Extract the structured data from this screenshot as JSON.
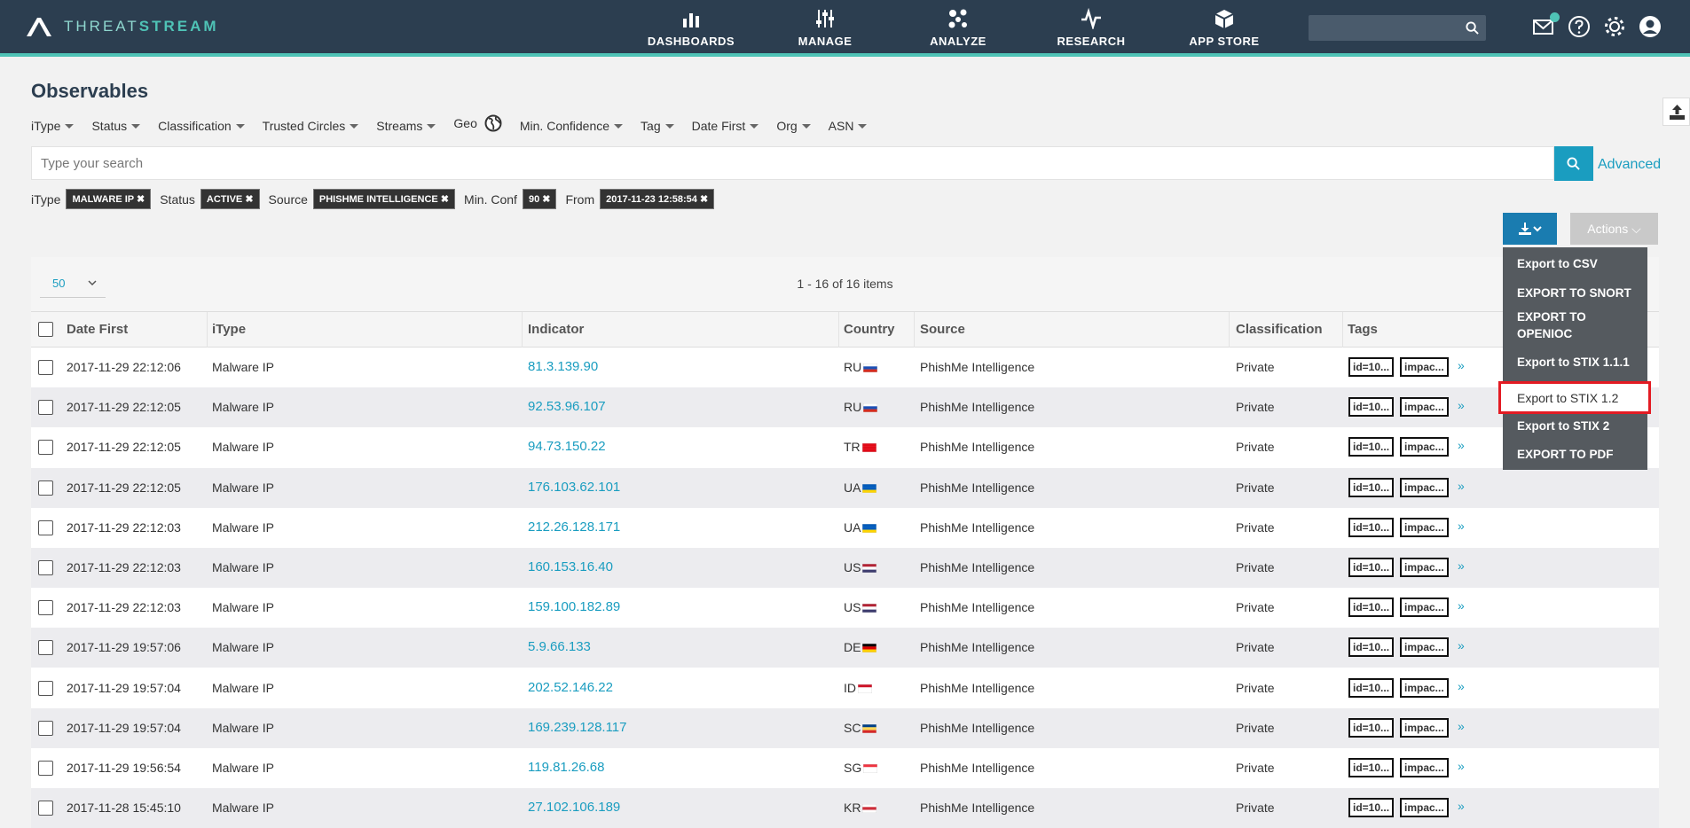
{
  "brand": {
    "name_light": "THREAT",
    "name_bold": "STREAM"
  },
  "nav": {
    "dashboards": "DASHBOARDS",
    "manage": "MANAGE",
    "analyze": "ANALYZE",
    "research": "RESEARCH",
    "app_store": "APP STORE"
  },
  "page_title": "Observables",
  "filters": {
    "itype": "iType",
    "status": "Status",
    "classification": "Classification",
    "trusted_circles": "Trusted Circles",
    "streams": "Streams",
    "geo": "Geo",
    "min_confidence": "Min. Confidence",
    "tag": "Tag",
    "date_first": "Date First",
    "org": "Org",
    "asn": "ASN"
  },
  "search": {
    "placeholder": "Type your search",
    "advanced_label": "Advanced"
  },
  "active_filters": {
    "itype_label": "iType",
    "itype_value": "MALWARE IP ✖",
    "status_label": "Status",
    "status_value": "ACTIVE ✖",
    "source_label": "Source",
    "source_value": "PHISHME INTELLIGENCE ✖",
    "minconf_label": "Min. Conf",
    "minconf_value": "90 ✖",
    "from_label": "From",
    "from_value": "2017-11-23 12:58:54 ✖"
  },
  "toolbar": {
    "actions_label": "Actions ⌵"
  },
  "export_menu": {
    "csv": "Export to CSV",
    "snort": "EXPORT TO SNORT",
    "openioc": "EXPORT TO OPENIOC",
    "stix111": "Export to STIX 1.1.1",
    "stix12": "Export to STIX 1.2",
    "stix2": "Export to STIX 2",
    "pdf": "EXPORT TO PDF"
  },
  "pager": {
    "page_size": "50",
    "info": "1 - 16 of 16 items"
  },
  "columns": {
    "date_first": "Date First",
    "itype": "iType",
    "indicator": "Indicator",
    "country": "Country",
    "source": "Source",
    "classification": "Classification",
    "tags": "Tags"
  },
  "rows": [
    {
      "date": "2017-11-29 22:12:06",
      "itype": "Malware IP",
      "indicator": "81.3.139.90",
      "country": "RU",
      "source": "PhishMe Intelligence",
      "classification": "Private",
      "tag1": "id=10...",
      "tag2": "impac...",
      "more": "»"
    },
    {
      "date": "2017-11-29 22:12:05",
      "itype": "Malware IP",
      "indicator": "92.53.96.107",
      "country": "RU",
      "source": "PhishMe Intelligence",
      "classification": "Private",
      "tag1": "id=10...",
      "tag2": "impac...",
      "more": "»"
    },
    {
      "date": "2017-11-29 22:12:05",
      "itype": "Malware IP",
      "indicator": "94.73.150.22",
      "country": "TR",
      "source": "PhishMe Intelligence",
      "classification": "Private",
      "tag1": "id=10...",
      "tag2": "impac...",
      "more": "»"
    },
    {
      "date": "2017-11-29 22:12:05",
      "itype": "Malware IP",
      "indicator": "176.103.62.101",
      "country": "UA",
      "source": "PhishMe Intelligence",
      "classification": "Private",
      "tag1": "id=10...",
      "tag2": "impac...",
      "more": "»"
    },
    {
      "date": "2017-11-29 22:12:03",
      "itype": "Malware IP",
      "indicator": "212.26.128.171",
      "country": "UA",
      "source": "PhishMe Intelligence",
      "classification": "Private",
      "tag1": "id=10...",
      "tag2": "impac...",
      "more": "»"
    },
    {
      "date": "2017-11-29 22:12:03",
      "itype": "Malware IP",
      "indicator": "160.153.16.40",
      "country": "US",
      "source": "PhishMe Intelligence",
      "classification": "Private",
      "tag1": "id=10...",
      "tag2": "impac...",
      "more": "»"
    },
    {
      "date": "2017-11-29 22:12:03",
      "itype": "Malware IP",
      "indicator": "159.100.182.89",
      "country": "US",
      "source": "PhishMe Intelligence",
      "classification": "Private",
      "tag1": "id=10...",
      "tag2": "impac...",
      "more": "»"
    },
    {
      "date": "2017-11-29 19:57:06",
      "itype": "Malware IP",
      "indicator": "5.9.66.133",
      "country": "DE",
      "source": "PhishMe Intelligence",
      "classification": "Private",
      "tag1": "id=10...",
      "tag2": "impac...",
      "more": "»"
    },
    {
      "date": "2017-11-29 19:57:04",
      "itype": "Malware IP",
      "indicator": "202.52.146.22",
      "country": "ID",
      "source": "PhishMe Intelligence",
      "classification": "Private",
      "tag1": "id=10...",
      "tag2": "impac...",
      "more": "»"
    },
    {
      "date": "2017-11-29 19:57:04",
      "itype": "Malware IP",
      "indicator": "169.239.128.117",
      "country": "SC",
      "source": "PhishMe Intelligence",
      "classification": "Private",
      "tag1": "id=10...",
      "tag2": "impac...",
      "more": "»"
    },
    {
      "date": "2017-11-29 19:56:54",
      "itype": "Malware IP",
      "indicator": "119.81.26.68",
      "country": "SG",
      "source": "PhishMe Intelligence",
      "classification": "Private",
      "tag1": "id=10...",
      "tag2": "impac...",
      "more": "»"
    },
    {
      "date": "2017-11-28 15:45:10",
      "itype": "Malware IP",
      "indicator": "27.102.106.189",
      "country": "KR",
      "source": "PhishMe Intelligence",
      "classification": "Private",
      "tag1": "id=10...",
      "tag2": "impac...",
      "more": "»"
    }
  ],
  "icons": {
    "logo": "threatstream-logo-icon",
    "dashboards": "bar-chart-icon",
    "manage": "sliders-icon",
    "analyze": "network-icon",
    "research": "pulse-icon",
    "app_store": "box-icon",
    "search": "search-icon",
    "mail": "mail-icon",
    "help": "help-icon",
    "settings": "gear-icon",
    "user": "user-icon",
    "geo": "globe-icon",
    "upload": "upload-icon",
    "download": "download-icon"
  },
  "colors": {
    "nav_bg": "#2c3e50",
    "accent_teal": "#4fc3b6",
    "link_blue": "#1a9dc0",
    "export_blue": "#1a7cb0",
    "highlight_red": "#e31b23"
  }
}
